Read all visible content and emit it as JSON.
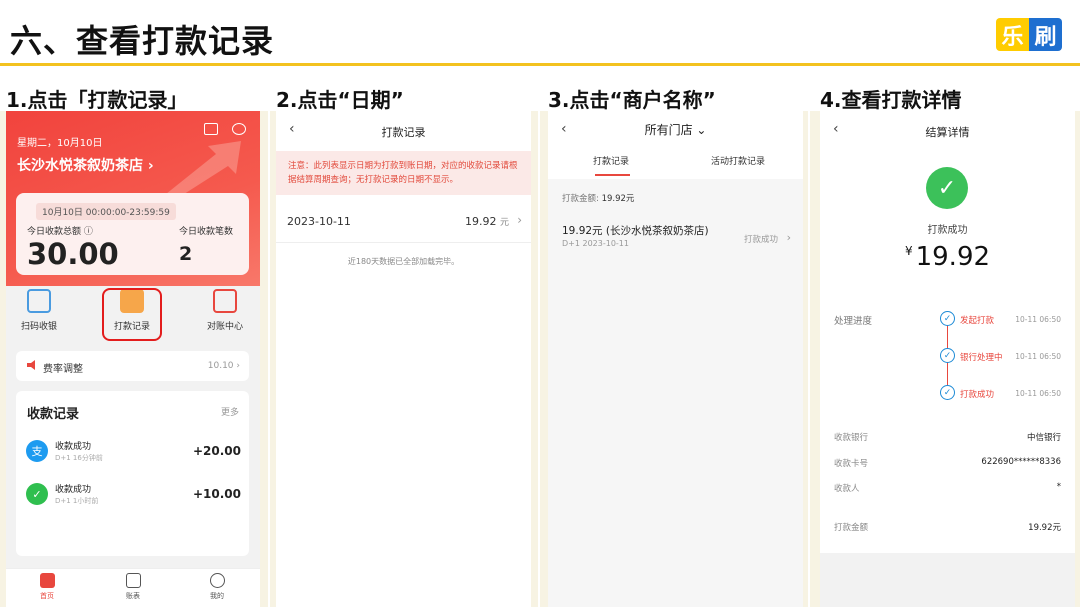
{
  "slide": {
    "title": "六、查看打款记录",
    "logo": [
      "乐",
      "刷"
    ],
    "steps": [
      "1.点击「打款记录」",
      "2.点击“日期”",
      "3.点击“商户名称”",
      "4.查看打款详情"
    ]
  },
  "phone1": {
    "date": "星期二，10月10日",
    "shop": "长沙水悦茶叙奶茶店 ›",
    "range": "10月10日 00:00:00-23:59:59",
    "total_label": "今日收款总额 ⓘ",
    "total_value": "30.00",
    "count_label": "今日收款笔数",
    "count_value": "2",
    "tools": [
      "扫码收银",
      "打款记录",
      "对账中心"
    ],
    "fee_label": "费率调整",
    "fee_value": "10.10 ›",
    "records_title": "收款记录",
    "records_more": "更多",
    "records": [
      {
        "icon": "支",
        "title": "收款成功",
        "sub": "D+1   16分钟前",
        "amount": "+20.00"
      },
      {
        "icon": "✓",
        "title": "收款成功",
        "sub": "D+1   1小时前",
        "amount": "+10.00"
      }
    ],
    "tabs": [
      "首页",
      "账表",
      "我的"
    ]
  },
  "phone2": {
    "title": "打款记录",
    "back": "‹",
    "note": "注意：此列表显示日期为打款到账日期，对应的收款记录请根据结算周期查询；无打款记录的日期不显示。",
    "row_date": "2023-10-11",
    "row_amount": "19.92",
    "row_unit": "元",
    "chevron": "›",
    "footer": "近180天数据已全部加载完毕。"
  },
  "phone3": {
    "title": "所有门店 ⌄",
    "back": "‹",
    "tab_active": "打款记录",
    "tab_other": "活动打款记录",
    "sum_label": "打款金额:",
    "sum_value": "19.92元",
    "item_amount": "19.92元 (长沙水悦茶叙奶茶店)",
    "item_sub": "D+1   2023-10-11",
    "item_status": "打款成功",
    "chevron": "›"
  },
  "phone4": {
    "title": "结算详情",
    "back": "‹",
    "check": "✓",
    "status": "打款成功",
    "currency": "¥",
    "amount": "19.92",
    "progress_label": "处理进度",
    "timeline": [
      {
        "label": "发起打款",
        "time": "10-11 06:50"
      },
      {
        "label": "银行处理中",
        "time": "10-11 06:50"
      },
      {
        "label": "打款成功",
        "time": "10-11 06:50"
      }
    ],
    "fields": [
      {
        "k": "收款银行",
        "v": "中信银行"
      },
      {
        "k": "收款卡号",
        "v": "622690******8336"
      },
      {
        "k": "收款人",
        "v": "*"
      },
      {
        "k": "打款金额",
        "v": "19.92元"
      }
    ]
  },
  "colors": {
    "accent": "#e8473e",
    "brand_yellow": "#f3c21f",
    "brand_blue": "#1e6fd0",
    "success": "#3cc15a"
  }
}
